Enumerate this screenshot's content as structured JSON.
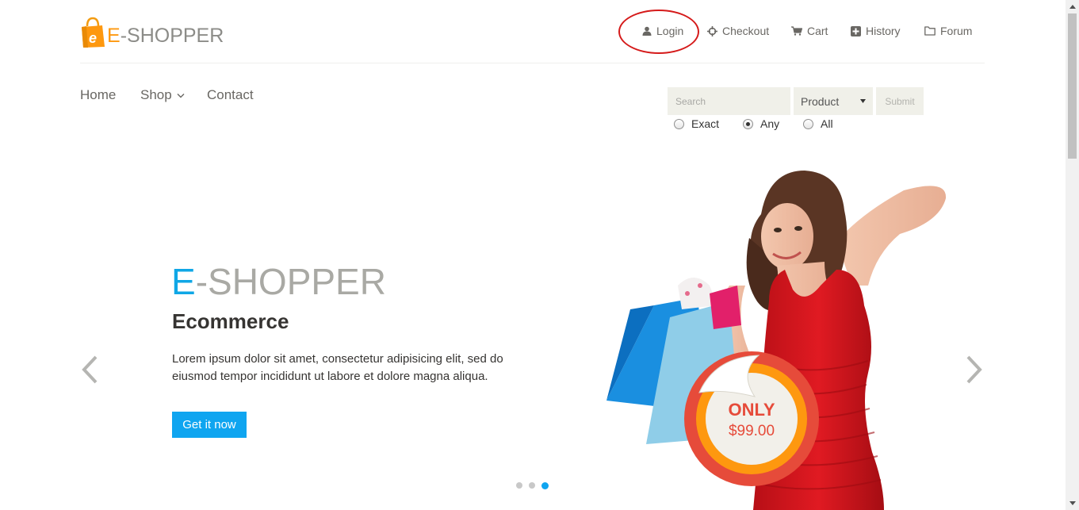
{
  "header": {
    "logo": {
      "accent_letter": "E",
      "rest": "-SHOPPER",
      "bag_letter": "e"
    },
    "top_nav": [
      {
        "label": "Login",
        "icon": "user-icon"
      },
      {
        "label": "Checkout",
        "icon": "crosshairs-icon"
      },
      {
        "label": "Cart",
        "icon": "cart-icon"
      },
      {
        "label": "History",
        "icon": "plus-square-icon"
      },
      {
        "label": "Forum",
        "icon": "folder-icon"
      }
    ]
  },
  "main_nav": [
    {
      "label": "Home"
    },
    {
      "label": "Shop",
      "has_dropdown": true
    },
    {
      "label": "Contact"
    }
  ],
  "search": {
    "placeholder": "Search",
    "select_value": "Product",
    "submit_label": "Submit",
    "options": [
      {
        "label": "Exact",
        "checked": false
      },
      {
        "label": "Any",
        "checked": true
      },
      {
        "label": "All",
        "checked": false
      }
    ]
  },
  "hero": {
    "brand_accent": "E",
    "brand_rest": "-SHOPPER",
    "heading": "Ecommerce",
    "description": "Lorem ipsum dolor sit amet, consectetur adipisicing elit, sed do eiusmod tempor incididunt ut labore et dolore magna aliqua.",
    "cta_label": "Get it now",
    "badge_only": "ONLY",
    "badge_price": "$99.00",
    "slides_total": 3,
    "active_slide": 3
  },
  "colors": {
    "brand_orange": "#fe980f",
    "accent_blue": "#0fa5f0",
    "annotation_red": "#d51a1a",
    "dress_red": "#d8141b"
  }
}
